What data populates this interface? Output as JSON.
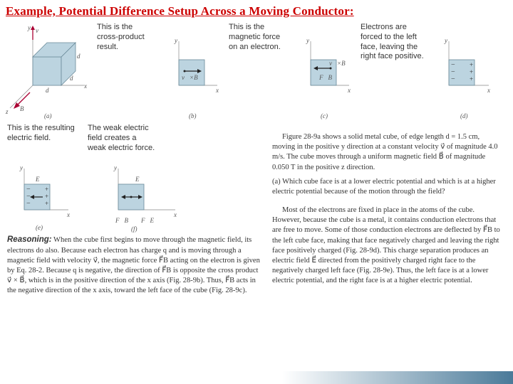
{
  "title": "Example, Potential Difference Setup Across a Moving Conductor:",
  "captions": {
    "b": "This is the cross-product result.",
    "c": "This is the magnetic force on an electron.",
    "d": "Electrons are forced to the left face, leaving the right face positive.",
    "e": "This is the resulting electric field.",
    "f": "The weak electric field creates a weak electric force."
  },
  "fig_labels": {
    "a": "(a)",
    "b": "(b)",
    "c": "(c)",
    "d": "(d)",
    "e": "(e)",
    "f": "(f)",
    "x": "x",
    "y": "y",
    "z": "z",
    "d_dim": "d",
    "v": "v⃗",
    "B": "B⃗",
    "vxB": "v⃗ × B⃗",
    "FB": "F⃗B",
    "FE": "F⃗E",
    "E": "E⃗"
  },
  "problem_text": "Figure 28-9a shows a solid metal cube, of edge length d = 1.5 cm, moving in the positive y direction at a constant velocity v⃗ of magnitude 4.0 m/s. The cube moves through a uniform magnetic field B⃗ of magnitude 0.050 T in the positive z direction.",
  "question_a": "(a) Which cube face is at a lower electric potential and which is at a higher electric potential because of the motion through the field?",
  "right_para": "Most of the electrons are fixed in place in the atoms of the cube. However, because the cube is a metal, it contains conduction electrons that are free to move. Some of those conduction electrons are deflected by F⃗B to the left cube face, making that face negatively charged and leaving the right face positively charged (Fig. 28-9d). This charge separation produces an electric field E⃗ directed from the positively charged right face to the negatively charged left face (Fig. 28-9e). Thus, the left face is at a lower electric potential, and the right face is at a higher electric potential.",
  "reasoning_label": "Reasoning:",
  "reasoning_text": " When the cube first begins to move through the magnetic field, its electrons do also. Because each electron has charge q and is moving through a magnetic field with velocity v⃗, the magnetic force F⃗B acting on the electron is given by Eq. 28-2. Because q is negative, the direction of F⃗B is opposite the cross product v⃗ × B⃗, which is in the positive direction of the x axis (Fig. 28-9b). Thus, F⃗B acts in the negative direction of the x axis, toward the left face of the cube (Fig. 28-9c)."
}
